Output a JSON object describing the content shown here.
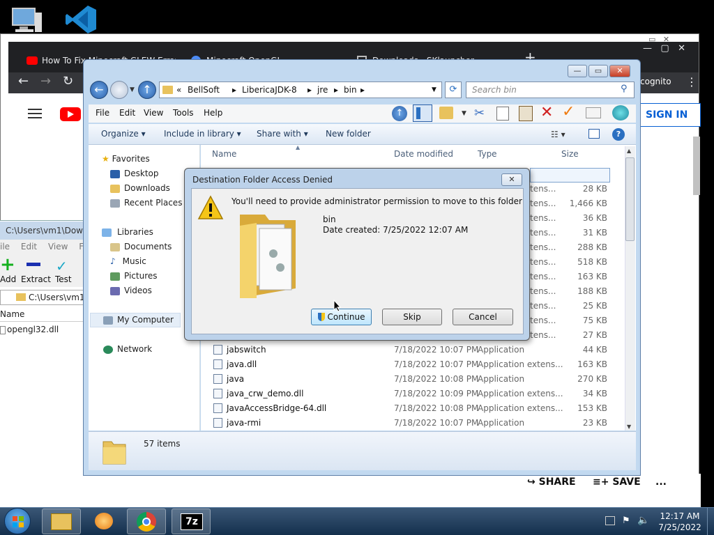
{
  "desktop": {
    "icons": [
      "computer-icon",
      "vscode-icon"
    ]
  },
  "chrome": {
    "tabs": [
      {
        "label": "How To Fix Minecraft GLEW Error"
      },
      {
        "label": "Minecraft OpenGL"
      },
      {
        "label": "Downloads - SKlauncher"
      }
    ],
    "incognito_label": "cognito",
    "signin_label": "SIGN IN",
    "share_label": "SHARE",
    "save_label": "SAVE",
    "more_label": "..."
  },
  "zip": {
    "title": "C:\\Users\\vm1\\Downl",
    "menu": [
      "ile",
      "Edit",
      "View",
      "Favo"
    ],
    "tools": {
      "add": "Add",
      "extract": "Extract",
      "test": "Test"
    },
    "path": "C:\\Users\\vm1\\",
    "col_name": "Name",
    "file": "opengl32.dll"
  },
  "explorer": {
    "breadcrumb": [
      "«",
      "BellSoft",
      "LibericaJDK-8",
      "jre",
      "bin"
    ],
    "search_placeholder": "Search bin",
    "menu": [
      "File",
      "Edit",
      "View",
      "Tools",
      "Help"
    ],
    "commands": {
      "organize": "Organize",
      "include": "Include in library",
      "share": "Share with",
      "newfolder": "New folder"
    },
    "nav": {
      "favorites": "Favorites",
      "desktop": "Desktop",
      "downloads": "Downloads",
      "recent": "Recent Places",
      "libraries": "Libraries",
      "documents": "Documents",
      "music": "Music",
      "pictures": "Pictures",
      "videos": "Videos",
      "mycomputer": "My Computer",
      "network": "Network"
    },
    "columns": {
      "name": "Name",
      "date": "Date modified",
      "type": "Type",
      "size": "Size"
    },
    "partial_rows": [
      {
        "type": "tens...",
        "size": "28 KB"
      },
      {
        "type": "tens...",
        "size": "1,466 KB"
      },
      {
        "type": "tens...",
        "size": "36 KB"
      },
      {
        "type": "tens...",
        "size": "31 KB"
      },
      {
        "type": "tens...",
        "size": "288 KB"
      },
      {
        "type": "tens...",
        "size": "518 KB"
      },
      {
        "type": "tens...",
        "size": "163 KB"
      },
      {
        "type": "tens...",
        "size": "188 KB"
      },
      {
        "type": "tens...",
        "size": "25 KB"
      },
      {
        "type": "tens...",
        "size": "75 KB"
      },
      {
        "type": "tens...",
        "size": "27 KB"
      }
    ],
    "rows": [
      {
        "name": "jabswitch",
        "date": "7/18/2022 10:07 PM",
        "type": "Application",
        "size": "44 KB"
      },
      {
        "name": "java.dll",
        "date": "7/18/2022 10:07 PM",
        "type": "Application extens...",
        "size": "163 KB"
      },
      {
        "name": "java",
        "date": "7/18/2022 10:08 PM",
        "type": "Application",
        "size": "270 KB"
      },
      {
        "name": "java_crw_demo.dll",
        "date": "7/18/2022 10:09 PM",
        "type": "Application extens...",
        "size": "34 KB"
      },
      {
        "name": "JavaAccessBridge-64.dll",
        "date": "7/18/2022 10:08 PM",
        "type": "Application extens...",
        "size": "153 KB"
      },
      {
        "name": "java-rmi",
        "date": "7/18/2022 10:07 PM",
        "type": "Application",
        "size": "23 KB"
      }
    ],
    "status_count": "57 items"
  },
  "dialog": {
    "title": "Destination Folder Access Denied",
    "close_label": "✕",
    "message": "You'll need to provide administrator permission to move to this folder",
    "item_name": "bin",
    "item_date": "Date created: 7/25/2022 12:07 AM",
    "continue_label": "Continue",
    "skip_label": "Skip",
    "cancel_label": "Cancel"
  },
  "taskbar": {
    "time": "12:17 AM",
    "date": "7/25/2022",
    "apps": [
      "start-orb-icon",
      "explorer-icon",
      "media-player-icon",
      "chrome-icon",
      "7zip-icon"
    ],
    "sevenzip_label": "7z"
  },
  "colors": {
    "aero_frame": "#c2d9f0",
    "chrome_dark": "#202124",
    "youtube_red": "#ff0000",
    "link_blue": "#065fd4",
    "taskbar": "#14304d"
  }
}
